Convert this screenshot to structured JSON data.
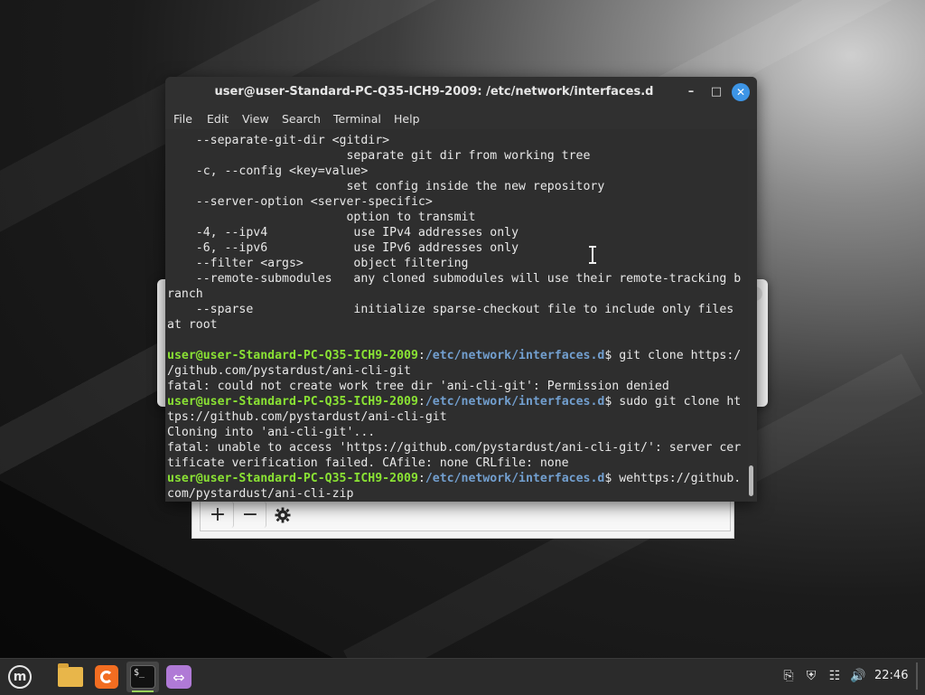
{
  "terminal": {
    "title": "user@user-Standard-PC-Q35-ICH9-2009: /etc/network/interfaces.d",
    "menu": [
      "File",
      "Edit",
      "View",
      "Search",
      "Terminal",
      "Help"
    ],
    "lines": {
      "l0": "    --separate-git-dir <gitdir>",
      "l1": "                         separate git dir from working tree",
      "l2": "    -c, --config <key=value>",
      "l3": "                         set config inside the new repository",
      "l4": "    --server-option <server-specific>",
      "l5": "                         option to transmit",
      "l6": "    -4, --ipv4            use IPv4 addresses only",
      "l7": "    -6, --ipv6            use IPv6 addresses only",
      "l8": "    --filter <args>       object filtering",
      "l9": "    --remote-submodules   any cloned submodules will use their remote-tracking b",
      "l10": "ranch",
      "l11": "    --sparse              initialize sparse-checkout file to include only files",
      "l12": "at root",
      "l14_cmd": "$ git clone https:/",
      "l15": "/github.com/pystardust/ani-cli-git",
      "l16": "fatal: could not create work tree dir 'ani-cli-git': Permission denied",
      "l17_cmd": "$ sudo git clone ht",
      "l18": "tps://github.com/pystardust/ani-cli-git",
      "l19": "Cloning into 'ani-cli-git'...",
      "l20": "fatal: unable to access 'https://github.com/pystardust/ani-cli-git/': server cer",
      "l21": "tificate verification failed. CAfile: none CRLfile: none",
      "l22_cmd": "$ wehttps://github.",
      "l23": "com/pystardust/ani-cli-zip"
    },
    "prompt_user": "user@user-Standard-PC-Q35-ICH9-2009",
    "prompt_sep": ":",
    "prompt_path": "/etc/network/interfaces.d"
  },
  "dialog": {
    "add_symbol": "+",
    "remove_symbol": "−",
    "settings_icon": "gear-icon"
  },
  "taskbar": {
    "clock": "22:46",
    "terminal_glyph": "$_"
  }
}
